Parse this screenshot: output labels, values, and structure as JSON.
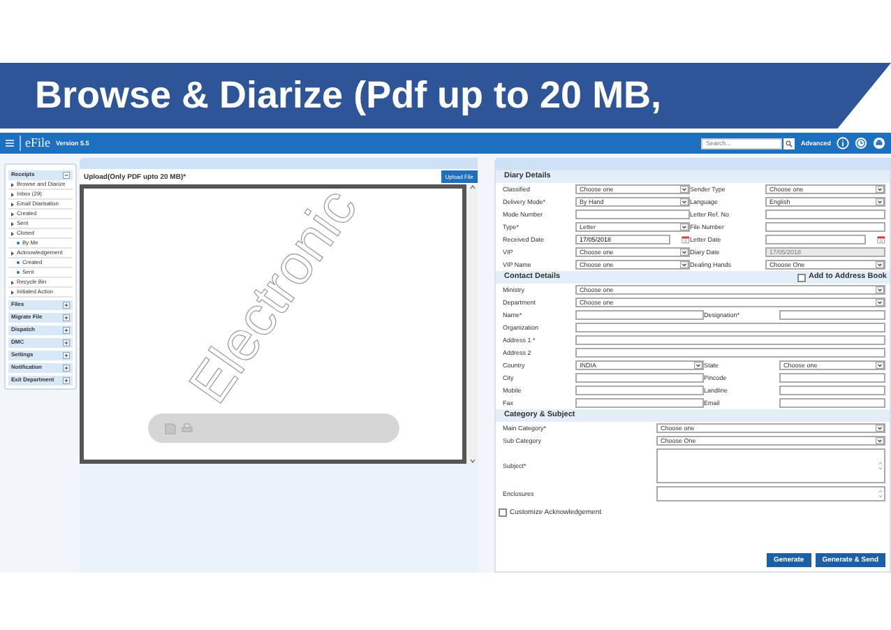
{
  "slide_title": "Browse & Diarize (Pdf up to 20 MB,",
  "app": {
    "logo": "eFile",
    "version": "Version 5.5",
    "search": {
      "placeholder": "Search..."
    },
    "advanced": "Advanced"
  },
  "sidebar": {
    "sections": [
      {
        "label": "Receipts",
        "expanded": true,
        "items": [
          {
            "label": "Browse and Diarize"
          },
          {
            "label": "Inbox (29)"
          },
          {
            "label": "Email Diarisation"
          },
          {
            "label": "Created"
          },
          {
            "label": "Sent"
          },
          {
            "label": "Closed",
            "children": [
              {
                "label": "By Me"
              }
            ]
          },
          {
            "label": "Acknowledgement",
            "children": [
              {
                "label": "Created"
              },
              {
                "label": "Sent"
              }
            ]
          },
          {
            "label": "Recycle Bin"
          },
          {
            "label": "Initiated Action"
          }
        ]
      },
      {
        "label": "Files",
        "expanded": false
      },
      {
        "label": "Migrate File",
        "expanded": false
      },
      {
        "label": "Dispatch",
        "expanded": false
      },
      {
        "label": "DMC",
        "expanded": false
      },
      {
        "label": "Settings",
        "expanded": false
      },
      {
        "label": "Notification",
        "expanded": false
      },
      {
        "label": "Exit Department",
        "expanded": false
      }
    ]
  },
  "viewer": {
    "title": "Upload(Only PDF upto 20 MB)*",
    "upload_button": "Upload File",
    "document_text": "Electronic"
  },
  "form": {
    "sections": [
      {
        "kind": "diary",
        "title": "Diary Details",
        "rows": [
          [
            {
              "label": "Classified",
              "kind": "select",
              "value": "Choose one"
            },
            {
              "label": "Sender Type",
              "kind": "select",
              "value": "Choose one"
            }
          ],
          [
            {
              "label": "Delivery Mode*",
              "kind": "select",
              "value": "By Hand"
            },
            {
              "label": "Language",
              "kind": "select",
              "value": "English"
            }
          ],
          [
            {
              "label": "Mode Number",
              "kind": "input"
            },
            {
              "label": "Letter Ref. No",
              "kind": "input"
            }
          ],
          [
            {
              "label": "Type*",
              "kind": "select",
              "value": "Letter"
            },
            {
              "label": "File Number",
              "kind": "input"
            }
          ],
          [
            {
              "label": "Received Date",
              "kind": "date",
              "value": "17/05/2018"
            },
            {
              "label": "Letter Date",
              "kind": "date"
            }
          ],
          [
            {
              "label": "VIP",
              "kind": "select",
              "value": "Choose one"
            },
            {
              "label": "Diary Date",
              "kind": "readonly",
              "value": "17/05/2018"
            }
          ],
          [
            {
              "label": "VIP Name",
              "kind": "select",
              "value": "Choose one"
            },
            {
              "label": "Dealing Hands",
              "kind": "select",
              "value": "Choose One"
            }
          ]
        ]
      },
      {
        "kind": "contact",
        "title": "Contact Details",
        "option": {
          "label": "Add to Address Book",
          "checked": false
        },
        "rows": [
          [
            {
              "label": "Ministry",
              "kind": "select",
              "value": "Choose one"
            }
          ],
          [
            {
              "label": "Department",
              "kind": "select",
              "value": "Choose one"
            }
          ],
          [
            {
              "label": "Name*",
              "kind": "input"
            },
            {
              "label": "Designation*",
              "kind": "input"
            }
          ],
          [
            {
              "label": "Organization",
              "kind": "input"
            }
          ],
          [
            {
              "label": "Address 1 *",
              "kind": "input"
            }
          ],
          [
            {
              "label": "Address 2",
              "kind": "input"
            }
          ],
          [
            {
              "label": "Country",
              "kind": "select",
              "value": "INDIA"
            },
            {
              "label": "State",
              "kind": "select",
              "value": "Choose one"
            }
          ],
          [
            {
              "label": "City",
              "kind": "input"
            },
            {
              "label": "Pincode",
              "kind": "input"
            }
          ],
          [
            {
              "label": "Mobile",
              "kind": "input"
            },
            {
              "label": "Landline",
              "kind": "input"
            }
          ],
          [
            {
              "label": "Fax",
              "kind": "input"
            },
            {
              "label": "Email",
              "kind": "input"
            }
          ]
        ]
      },
      {
        "kind": "category",
        "title": "Category & Subject",
        "rows": [
          [
            {
              "label": "Main Category*",
              "kind": "select",
              "value": "Choose one"
            }
          ],
          [
            {
              "label": "Sub Category",
              "kind": "select",
              "value": "Choose One"
            }
          ],
          [
            {
              "label": "Subject*",
              "kind": "textarea"
            }
          ],
          [
            {
              "label": "Enclosures",
              "kind": "textarea_small"
            }
          ]
        ]
      }
    ],
    "customize": {
      "label": "Customize Acknowledgement",
      "checked": false
    },
    "buttons": [
      "Generate",
      "Generate & Send"
    ]
  }
}
